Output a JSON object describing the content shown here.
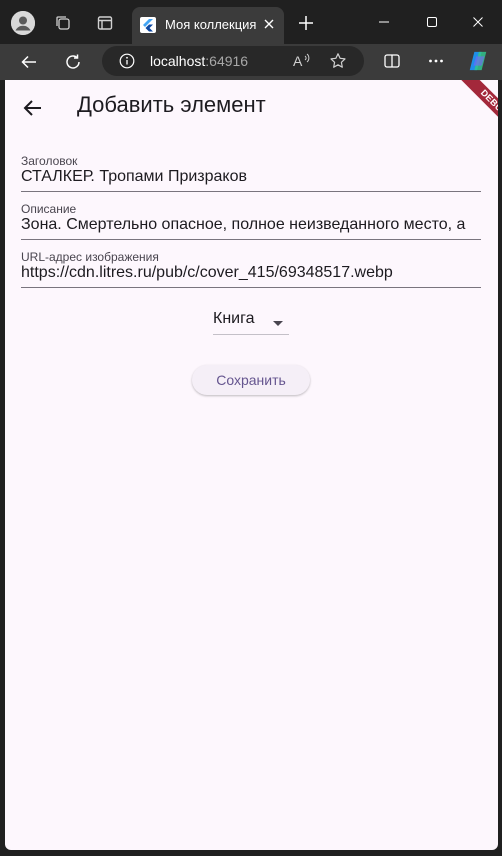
{
  "browser": {
    "tab": {
      "title": "Моя коллекция"
    },
    "address": {
      "host": "localhost",
      "port": ":64916"
    }
  },
  "app": {
    "title": "Добавить элемент",
    "debug_banner": "DEBUG",
    "fields": [
      {
        "label": "Заголовок",
        "value": "СТАЛКЕР. Тропами Призраков"
      },
      {
        "label": "Описание",
        "value": "Зона. Смертельно опасное, полное неизведанного место, а"
      },
      {
        "label": "URL-адрес изображения",
        "value": "https://cdn.litres.ru/pub/c/cover_415/69348517.webp"
      }
    ],
    "type_select": {
      "selected": "Книга"
    },
    "save_label": "Сохранить"
  },
  "colors": {
    "background": "#fdf7fd",
    "accent": "#65558f",
    "debug": "#a3283b"
  }
}
